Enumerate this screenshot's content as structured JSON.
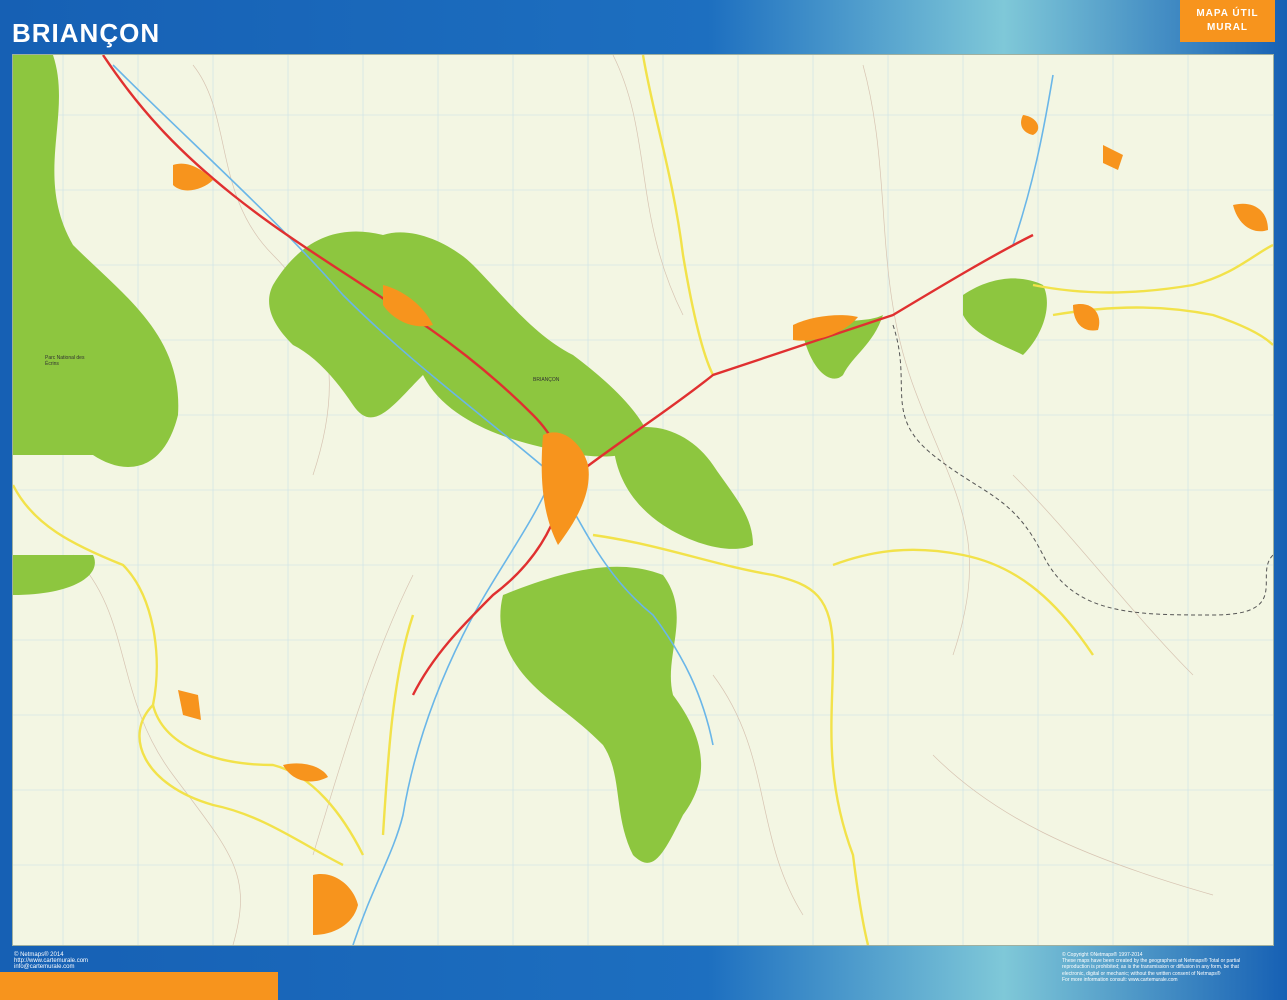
{
  "header": {
    "title": "BRIANÇON",
    "badge_line1": "MAPA ÚTIL",
    "badge_line2": "MURAL"
  },
  "footer": {
    "left_line1": "© Netmaps® 2014",
    "left_line2": "http://www.cartemurale.com",
    "left_line3": "info@cartemurale.com",
    "right_line1": "© Copyright ©Netmaps® 1997-2014",
    "right_line2": "These maps have been created by the geographers at Netmaps® Total or partial",
    "right_line3": "reproduction is prohibited; as is the transmission or diffusion in any form, be that",
    "right_line4": "electronic, digital or mechanic; without the written consent of Netmaps®",
    "right_line5": "For more information consult: www.cartemurale.com"
  },
  "map": {
    "labels": {
      "park": "Parc National des Écrins",
      "briancon": "BRIANÇON"
    },
    "colors": {
      "background": "#f3f6e3",
      "forest": "#8dc63f",
      "urban": "#f7941d",
      "main_road": "#e03030",
      "secondary_road": "#f2e24a",
      "river": "#6ab6e8",
      "grid": "#c9dfe8"
    }
  }
}
